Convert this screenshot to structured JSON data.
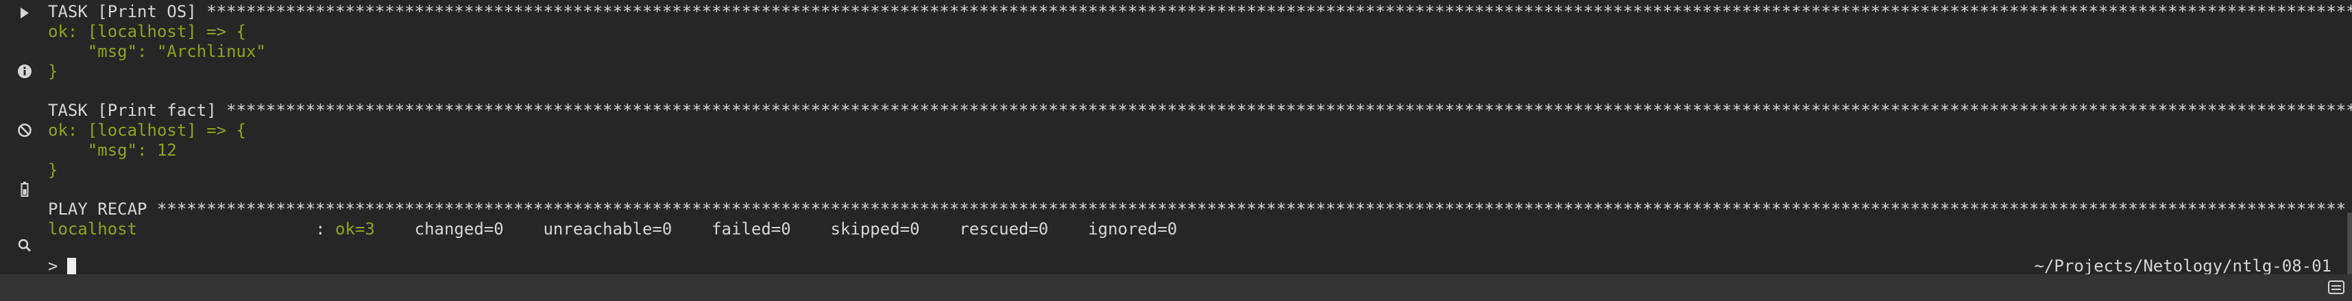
{
  "terminal": {
    "lines": [
      {
        "prefix": "TASK [Print OS] ",
        "stars": "**************************************************************************************************************************************************************************************************************************************************************************************************************************************************************************************"
      },
      {
        "text": "ok: [localhost] => {"
      },
      {
        "text": "    \"msg\": \"Archlinux\""
      },
      {
        "text": "}"
      },
      {
        "prefix": "TASK [Print fact] ",
        "stars": "************************************************************************************************************************************************************************************************************************************************************************************************************************************************************************************"
      },
      {
        "text": "ok: [localhost] => {"
      },
      {
        "text": "    \"msg\": 12"
      },
      {
        "text": "}"
      },
      {
        "prefix": "PLAY RECAP ",
        "stars": "*****************************************************************************************************************************************************************************************************************************************************************************************************************************************************************************************"
      }
    ],
    "recap": {
      "host": "localhost",
      "sep": "                  : ",
      "ok": "ok=3",
      "rest": "    changed=0    unreachable=0    failed=0    skipped=0    rescued=0    ignored=0"
    },
    "prompt": ">",
    "cwd": "~/Projects/Netology/ntlg-08-01"
  },
  "gutter_icons": [
    "play-icon",
    "info-icon",
    "block-icon",
    "battery-icon",
    "search-icon"
  ],
  "colors": {
    "background": "#262626",
    "text": "#d6d6d6",
    "ok_green": "#8fa51b",
    "statusbar": "#333333"
  }
}
